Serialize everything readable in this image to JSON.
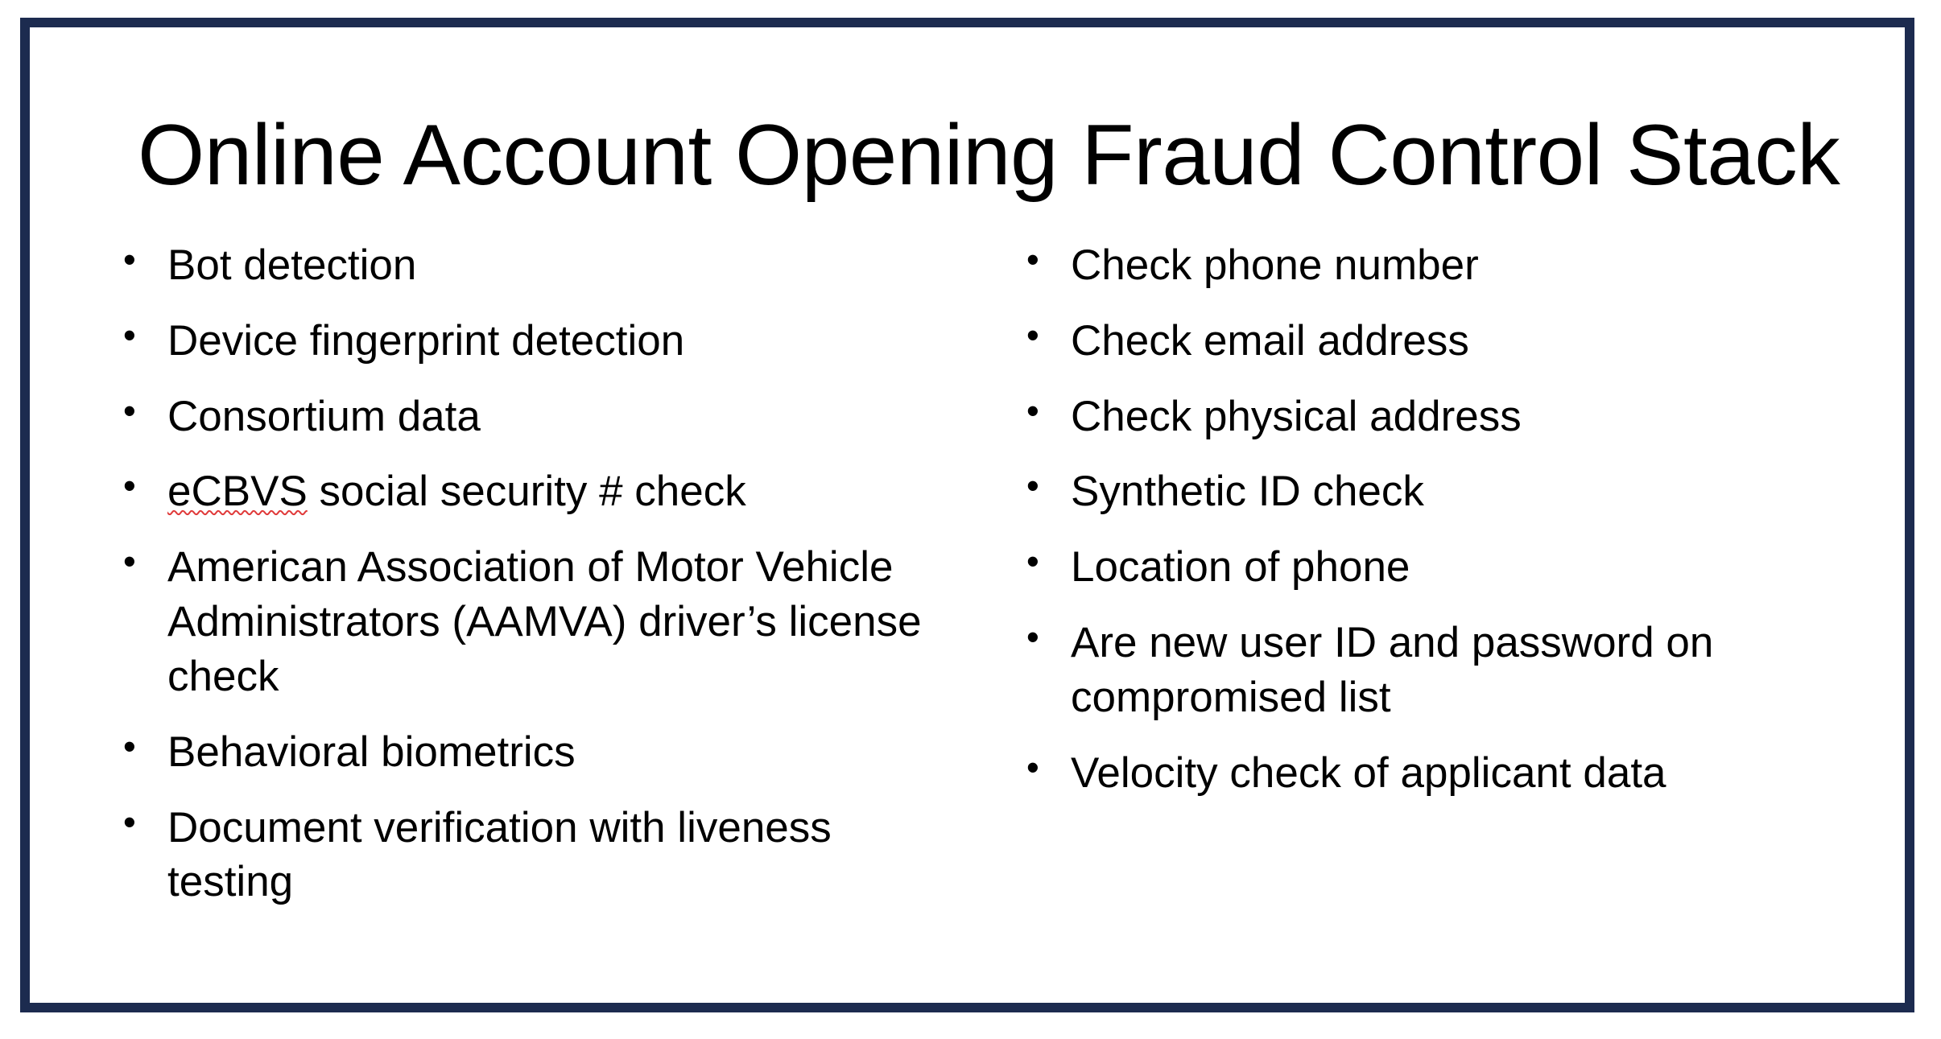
{
  "slide": {
    "title": "Online Account Opening Fraud Control Stack",
    "frame_color": "#1c2b4f",
    "background_color": "#ffffff",
    "text_color": "#000000",
    "bullet_glyph": "•",
    "spellcheck_underline_color": "#e03a3a",
    "columns": {
      "left": {
        "items": [
          {
            "text": "Bot detection"
          },
          {
            "text": "Device fingerprint detection"
          },
          {
            "text": "Consortium data"
          },
          {
            "text": "eCBVS social security # check",
            "misspelled_word": "eCBVS",
            "rest": " social security # check"
          },
          {
            "text": "American Association of Motor Vehicle Administrators (AAMVA) driver’s license check"
          },
          {
            "text": "Behavioral biometrics"
          },
          {
            "text": "Document verification with liveness testing"
          }
        ]
      },
      "right": {
        "items": [
          {
            "text": "Check phone number"
          },
          {
            "text": "Check email address"
          },
          {
            "text": "Check physical address"
          },
          {
            "text": "Synthetic ID check"
          },
          {
            "text": "Location of phone"
          },
          {
            "text": "Are new user ID and password on compromised list"
          },
          {
            "text": "Velocity check of applicant data"
          }
        ]
      }
    }
  }
}
